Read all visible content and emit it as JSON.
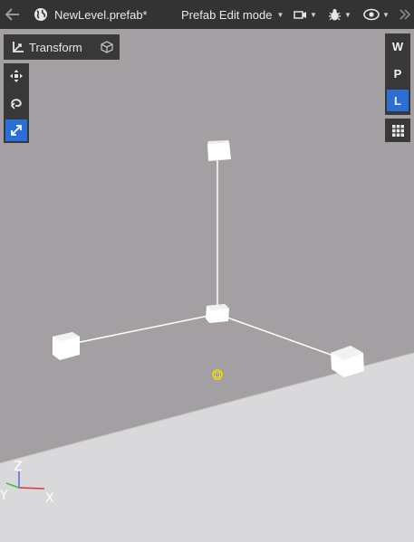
{
  "toolbar": {
    "back_icon": "arrow-left-icon",
    "world_icon": "globe-icon",
    "level_name": "NewLevel.prefab*",
    "mode_label": "Prefab Edit mode",
    "camera_icon": "camera-icon",
    "debug_icon": "bug-icon",
    "view_icon": "eye-icon",
    "overflow_icon": "double-chevron-right-icon"
  },
  "transform_panel": {
    "label": "Transform",
    "icon": "transform-axes-icon",
    "object_icon": "cube-icon"
  },
  "tools": [
    "move-icon",
    "rotate-icon",
    "scale-icon"
  ],
  "active_tool": "scale",
  "space_buttons": [
    {
      "label": "W",
      "active": false
    },
    {
      "label": "P",
      "active": false
    },
    {
      "label": "L",
      "active": true
    }
  ],
  "grid_icon": "grid-icon",
  "orientation": {
    "z": "Z",
    "y": "Y",
    "x": "X"
  },
  "colors": {
    "toolbar_bg": "#333333",
    "panel_bg": "#383838",
    "accent": "#2b6fd6",
    "backdrop": "#a39fa2",
    "floor": "#d9d9db",
    "axis_x": "#d23c3c",
    "axis_y": "#3fbf4f",
    "axis_z": "#5a6ad6",
    "pivot_marker": "#e8e200"
  }
}
